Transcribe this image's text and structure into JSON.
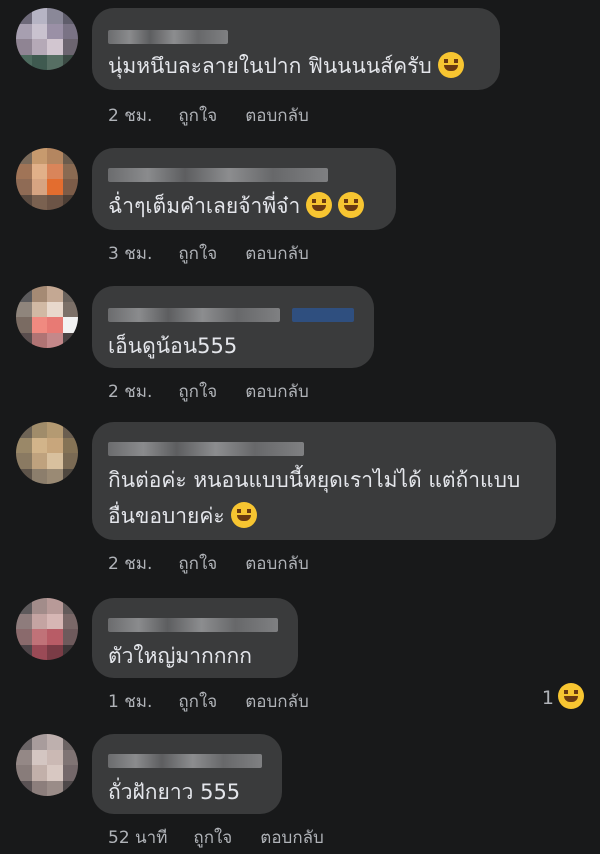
{
  "comments": [
    {
      "text": "นุ่มหนึบละลายในปาก ฟินนนนส์ครับ",
      "time": "2 ชม.",
      "like": "ถูกใจ",
      "reply": "ตอบกลับ",
      "emoji": "grinning-squint"
    },
    {
      "text": "ฉ่ำๆเต็มคำเลยจ้าพี่จ๋า",
      "time": "3 ชม.",
      "like": "ถูกใจ",
      "reply": "ตอบกลับ",
      "emoji": "rofl"
    },
    {
      "text": "เอ็นดูน้อน555",
      "time": "2 ชม.",
      "like": "ถูกใจ",
      "reply": "ตอบกลับ"
    },
    {
      "text_line1": "กินต่อค่ะ หนอนแบบนี้หยุดเราไม่ได้ แต่ถ้าแบบ",
      "text_line2": "อื่นขอบายค่ะ",
      "time": "2 ชม.",
      "like": "ถูกใจ",
      "reply": "ตอบกลับ",
      "emoji": "rofl"
    },
    {
      "text": "ตัวใหญ่มากกกก",
      "time": "1 ชม.",
      "like": "ถูกใจ",
      "reply": "ตอบกลับ",
      "reaction_count": "1",
      "reaction_emoji": "laughing"
    },
    {
      "text": "ถั่วฝักยาว 555",
      "time": "52 นาที",
      "like": "ถูกใจ",
      "reply": "ตอบกลับ"
    }
  ]
}
